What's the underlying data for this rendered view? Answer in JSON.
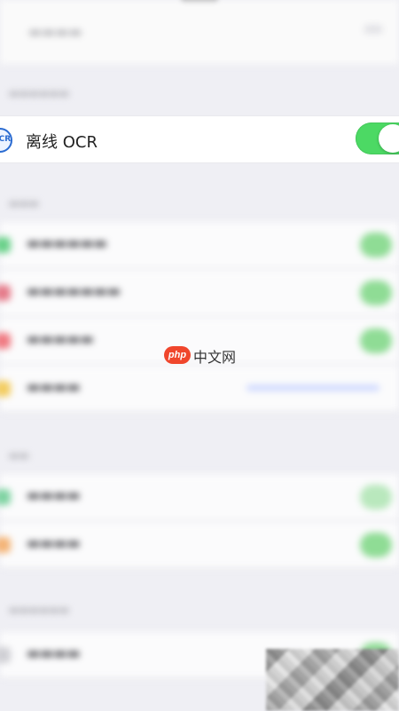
{
  "offline_ocr": {
    "label": "离线 OCR",
    "icon_text": "OCR",
    "enabled": true,
    "icon": "ocr-icon"
  },
  "watermark": {
    "pill_text": "php",
    "text": "中文网"
  },
  "colors": {
    "toggle_on": "#4cd964",
    "background": "#efeff4",
    "ocr_blue": "#2a6bd1",
    "watermark_red": "#f0462c"
  }
}
